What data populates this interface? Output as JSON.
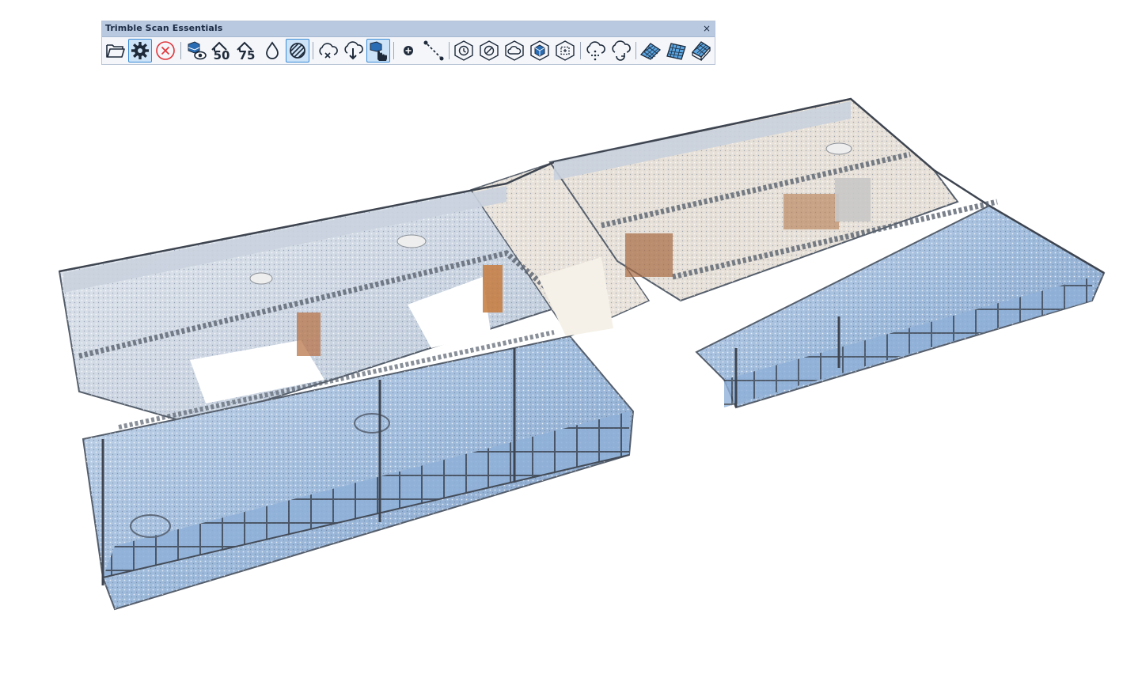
{
  "toolbar": {
    "title": "Trimble Scan Essentials",
    "close_glyph": "×",
    "buttons": [
      {
        "icon": "folder-open-icon"
      },
      {
        "icon": "gear-icon",
        "active": true
      },
      {
        "icon": "close-circle-icon"
      },
      {
        "icon": "scan-visibility-icon"
      },
      {
        "icon": "density-50-icon",
        "label": "50"
      },
      {
        "icon": "density-75-icon",
        "label": "75"
      },
      {
        "icon": "drop-icon"
      },
      {
        "icon": "striped-circle-icon",
        "active": true
      },
      {
        "icon": "cloud-remove-icon"
      },
      {
        "icon": "cloud-download-icon"
      },
      {
        "icon": "hand-select-icon",
        "active": true
      },
      {
        "icon": "add-point-icon"
      },
      {
        "icon": "measure-line-icon"
      },
      {
        "icon": "hex-history-icon"
      },
      {
        "icon": "hex-slash-icon"
      },
      {
        "icon": "hex-cloud-icon"
      },
      {
        "icon": "hex-cube-icon"
      },
      {
        "icon": "hex-crop-icon"
      },
      {
        "icon": "cloud-points-icon"
      },
      {
        "icon": "cloud-refresh-icon"
      },
      {
        "icon": "mesh-plane-1-icon"
      },
      {
        "icon": "mesh-plane-2-icon"
      },
      {
        "icon": "mesh-plane-3-icon"
      }
    ]
  },
  "colors": {
    "title_bar": "#b8c9e0",
    "toolbar_bg": "#f4f6fa",
    "active_border": "#3a8bd8",
    "active_bg": "#cde3f7",
    "icon_blue": "#2a6db5",
    "icon_dark": "#1e2a3a",
    "close_red": "#e0343a"
  },
  "viewport": {
    "content": "point-cloud-building-scan"
  }
}
